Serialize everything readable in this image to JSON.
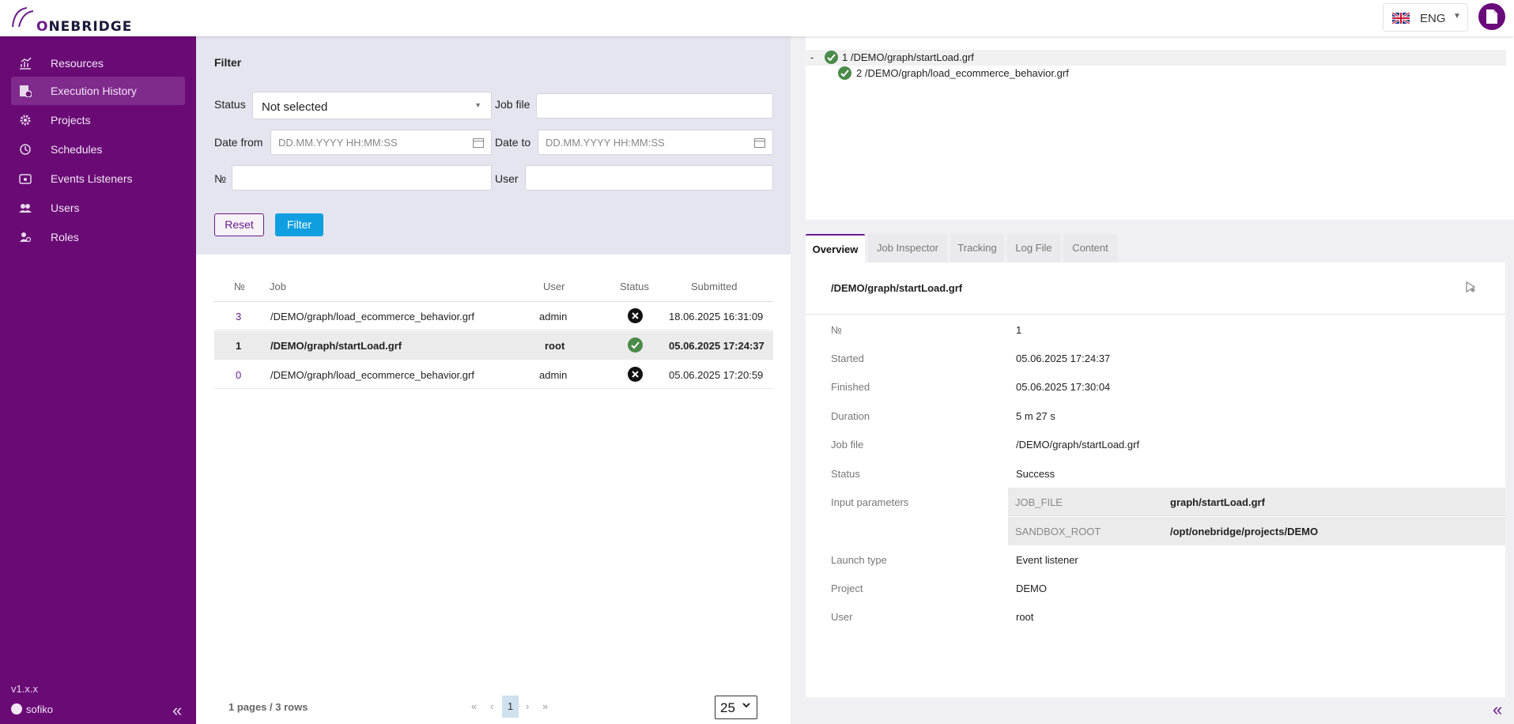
{
  "header": {
    "logo": "ONEBRIDGE",
    "language": "ENG"
  },
  "sidebar": {
    "items": [
      {
        "label": "Resources",
        "icon": "chart-icon"
      },
      {
        "label": "Execution History",
        "icon": "history-icon"
      },
      {
        "label": "Projects",
        "icon": "gear-icon"
      },
      {
        "label": "Schedules",
        "icon": "clock-icon"
      },
      {
        "label": "Events Listeners",
        "icon": "event-icon"
      },
      {
        "label": "Users",
        "icon": "users-icon"
      },
      {
        "label": "Roles",
        "icon": "role-icon"
      }
    ],
    "active": "Execution History",
    "version": "v1.x.x",
    "username": "sofiko"
  },
  "filter": {
    "title": "Filter",
    "status_label": "Status",
    "status_value": "Not selected",
    "job_file_label": "Job file",
    "date_from_label": "Date from",
    "date_from_placeholder": "DD.MM.YYYY HH:MM:SS",
    "date_to_label": "Date to",
    "date_to_placeholder": "DD.MM.YYYY HH:MM:SS",
    "number_label": "№",
    "user_label": "User",
    "reset_label": "Reset",
    "filter_label": "Filter"
  },
  "table": {
    "columns": [
      "№",
      "Job",
      "User",
      "Status",
      "Submitted"
    ],
    "rows": [
      {
        "num": "3",
        "job": "/DEMO/graph/load_ecommerce_behavior.grf",
        "user": "admin",
        "status": "failed",
        "submitted": "18.06.2025 16:31:09"
      },
      {
        "num": "1",
        "job": "/DEMO/graph/startLoad.grf",
        "user": "root",
        "status": "success",
        "submitted": "05.06.2025 17:24:37"
      },
      {
        "num": "0",
        "job": "/DEMO/graph/load_ecommerce_behavior.grf",
        "user": "admin",
        "status": "failed",
        "submitted": "05.06.2025 17:20:59"
      }
    ],
    "selected_row": 1
  },
  "pagination": {
    "info": "1 pages / 3 rows",
    "first": "«",
    "prev": "‹",
    "current": "1",
    "next": "›",
    "last": "»",
    "per_page": "25"
  },
  "tree": {
    "collapse": "-",
    "items": [
      {
        "label": "1 /DEMO/graph/startLoad.grf"
      },
      {
        "label": "2 /DEMO/graph/load_ecommerce_behavior.grf"
      }
    ]
  },
  "tabs": [
    "Overview",
    "Job Inspector",
    "Tracking",
    "Log File",
    "Content"
  ],
  "active_tab": "Overview",
  "detail": {
    "title": "/DEMO/graph/startLoad.grf",
    "fields": [
      {
        "label": "№",
        "value": "1"
      },
      {
        "label": "Started",
        "value": "05.06.2025 17:24:37"
      },
      {
        "label": "Finished",
        "value": "05.06.2025 17:30:04"
      },
      {
        "label": "Duration",
        "value": "5 m 27 s"
      },
      {
        "label": "Job file",
        "value": "/DEMO/graph/startLoad.grf"
      },
      {
        "label": "Status",
        "value": "Success"
      },
      {
        "label": "Input parameters",
        "value": ""
      },
      {
        "label": "Launch type",
        "value": "Event listener"
      },
      {
        "label": "Project",
        "value": "DEMO"
      },
      {
        "label": "User",
        "value": "root"
      }
    ],
    "params": [
      {
        "key": "JOB_FILE",
        "value": "graph/startLoad.grf"
      },
      {
        "key": "SANDBOX_ROOT",
        "value": "/opt/onebridge/projects/DEMO"
      }
    ]
  },
  "colors": {
    "brand": "#690a75",
    "accent_blue": "#0f9fe0",
    "success": "#4a8a4a"
  }
}
